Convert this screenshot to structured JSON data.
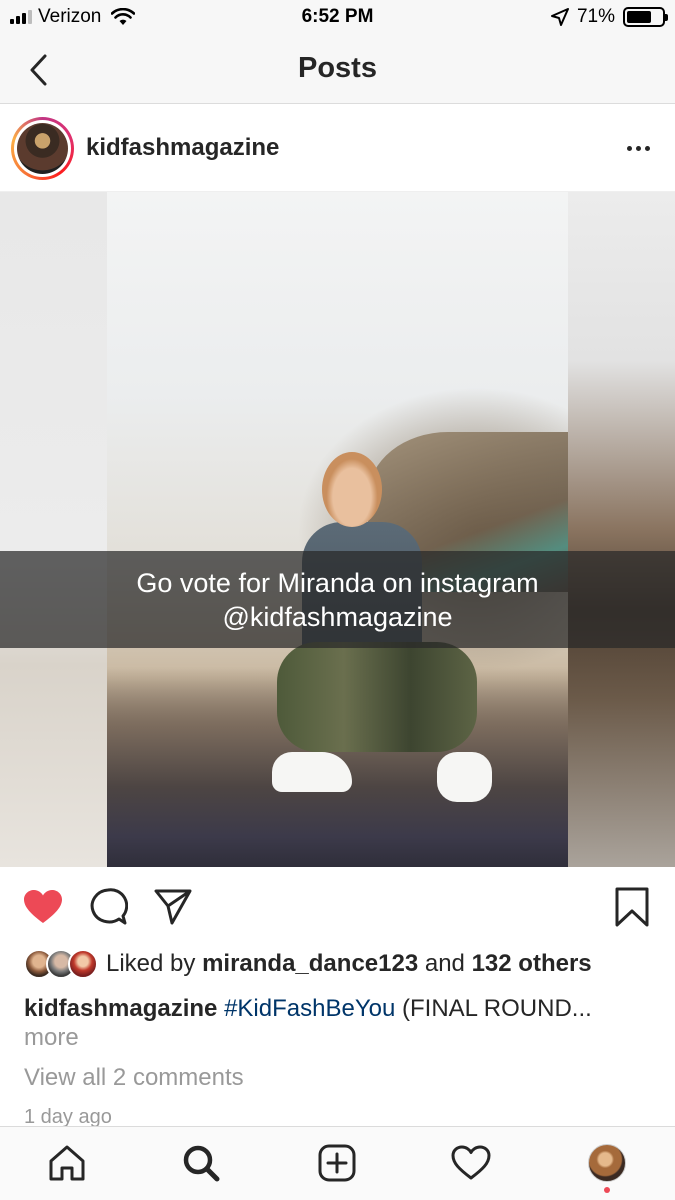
{
  "status_bar": {
    "carrier": "Verizon",
    "time": "6:52 PM",
    "battery": "71%",
    "battery_level": 0.71
  },
  "nav": {
    "title": "Posts",
    "back_icon": "chevron-left-icon"
  },
  "post": {
    "username": "kidfashmagazine",
    "overlay_text_line1": "Go vote for Miranda on instagram",
    "overlay_text_line2": "@kidfashmagazine",
    "liked": true,
    "likes_prefix": "Liked by",
    "liked_by_user": "miranda_dance123",
    "likes_and": "and",
    "likes_others": "132 others",
    "caption_user": "kidfashmagazine",
    "caption_hashtag": "#KidFashBeYou",
    "caption_text": "(FINAL ROUND...",
    "more_label": "more",
    "view_comments": "View all 2 comments",
    "timestamp": "1 day ago"
  },
  "colors": {
    "like_red": "#ed4956",
    "hashtag_blue": "#003569",
    "muted_text": "#999999"
  },
  "tab_bar": {
    "items": [
      "home-icon",
      "search-icon",
      "add-post-icon",
      "activity-heart-icon",
      "profile-avatar"
    ]
  }
}
